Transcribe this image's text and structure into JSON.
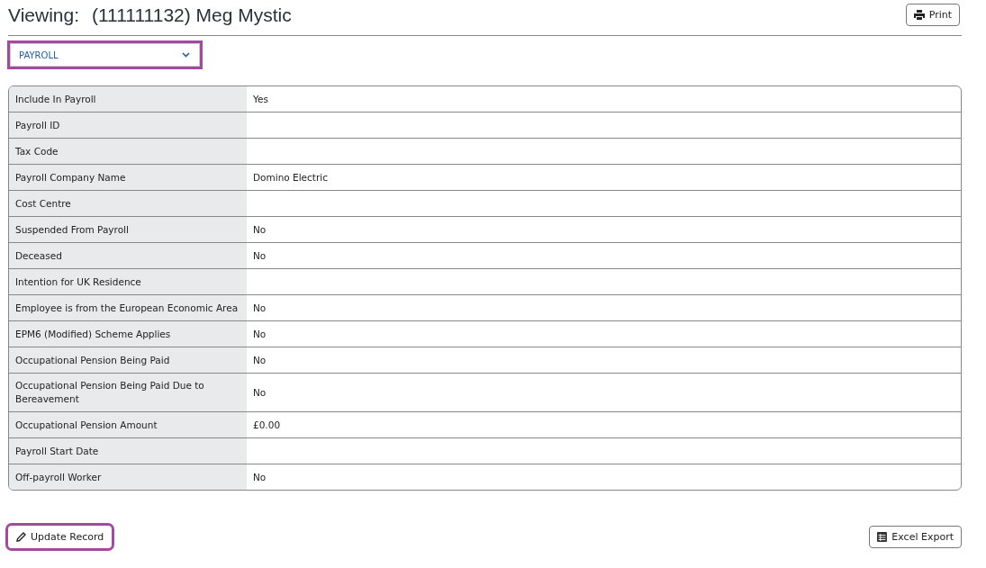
{
  "header": {
    "label": "Viewing:",
    "record": "(111111132) Meg Mystic"
  },
  "print_button": {
    "label": "Print"
  },
  "section_select": {
    "value": "PAYROLL",
    "highlighted": true
  },
  "details": [
    {
      "label": "Include In Payroll",
      "value": "Yes"
    },
    {
      "label": "Payroll ID"
    },
    {
      "label": "Tax Code"
    },
    {
      "label": "Payroll Company Name",
      "value": "Domino Electric"
    },
    {
      "label": "Cost Centre"
    },
    {
      "label": "Suspended From Payroll",
      "value": "No"
    },
    {
      "label": "Deceased",
      "value": "No"
    },
    {
      "label": "Intention for UK Residence"
    },
    {
      "label": "Employee is from the European Economic Area",
      "value": "No"
    },
    {
      "label": "EPM6 (Modified) Scheme Applies",
      "value": "No"
    },
    {
      "label": "Occupational Pension Being Paid",
      "value": "No"
    },
    {
      "label": "Occupational Pension Being Paid Due to Bereavement",
      "value": "No"
    },
    {
      "label": "Occupational Pension Amount",
      "value": "£0.00"
    },
    {
      "label": "Payroll Start Date"
    },
    {
      "label": "Off-payroll Worker",
      "value": "No"
    }
  ],
  "update_button": {
    "label": "Update Record",
    "highlighted": true
  },
  "export_button": {
    "label": "Excel Export"
  }
}
